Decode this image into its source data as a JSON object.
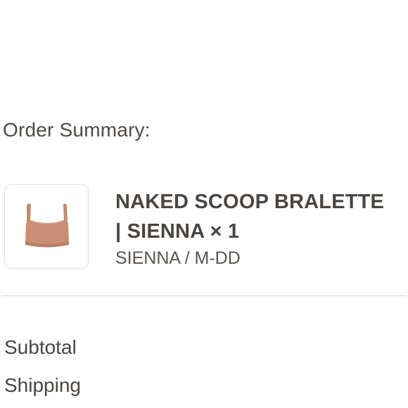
{
  "order_summary": {
    "heading": "Order Summary:"
  },
  "line_item": {
    "title_line1": "NAKED SCOOP BRALETTE",
    "title_line2": "| SIENNA × 1",
    "variant": "SIENNA / M-DD",
    "image_icon": "bralette-product-image",
    "color": "#c98e73"
  },
  "totals": {
    "subtotal_label": "Subtotal",
    "shipping_label": "Shipping"
  }
}
